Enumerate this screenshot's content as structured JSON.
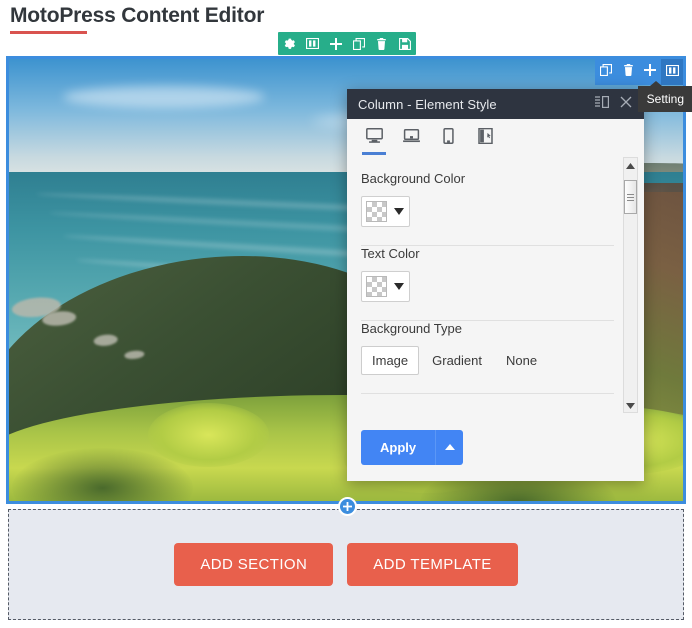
{
  "page": {
    "title": "MotoPress Content Editor",
    "accent_rule_color": "#d9534f"
  },
  "section_toolbar": {
    "buttons": [
      {
        "name": "gear-icon",
        "label": "Settings"
      },
      {
        "name": "columns-icon",
        "label": "Columns"
      },
      {
        "name": "plus-icon",
        "label": "Add"
      },
      {
        "name": "copy-icon",
        "label": "Duplicate"
      },
      {
        "name": "trash-icon",
        "label": "Delete"
      },
      {
        "name": "save-icon",
        "label": "Save"
      }
    ],
    "background_color": "#27ae8a"
  },
  "column_toolbar": {
    "buttons": [
      {
        "name": "copy-icon",
        "label": "Duplicate",
        "active": false
      },
      {
        "name": "trash-icon",
        "label": "Delete",
        "active": false
      },
      {
        "name": "plus-icon",
        "label": "Add",
        "active": false
      },
      {
        "name": "columns-icon",
        "label": "Settings",
        "active": true
      }
    ],
    "background_color": "#3c8dde",
    "tooltip": "Setting"
  },
  "modal": {
    "title": "Column - Element Style",
    "header_buttons": [
      {
        "name": "dock-layout-icon",
        "label": "Dock"
      },
      {
        "name": "close-icon",
        "label": "Close"
      }
    ],
    "device_tabs": [
      {
        "name": "desktop-icon",
        "label": "Desktop",
        "active": true
      },
      {
        "name": "laptop-icon",
        "label": "Laptop",
        "active": false
      },
      {
        "name": "mobile-icon",
        "label": "Mobile",
        "active": false
      },
      {
        "name": "responsive-panel-icon",
        "label": "Responsive",
        "active": false
      }
    ],
    "fields": {
      "background_color": {
        "label": "Background Color",
        "value": "transparent"
      },
      "text_color": {
        "label": "Text Color",
        "value": "transparent"
      },
      "background_type": {
        "label": "Background Type",
        "options": [
          "Image",
          "Gradient",
          "None"
        ],
        "selected": "Image"
      }
    },
    "footer": {
      "apply_label": "Apply",
      "apply_color": "#4285f4"
    }
  },
  "add_area": {
    "add_section_label": "ADD SECTION",
    "add_template_label": "ADD TEMPLATE",
    "button_color": "#e8604c",
    "background_color": "#e6e9f0"
  },
  "add_row": {
    "plus_label": "+"
  }
}
